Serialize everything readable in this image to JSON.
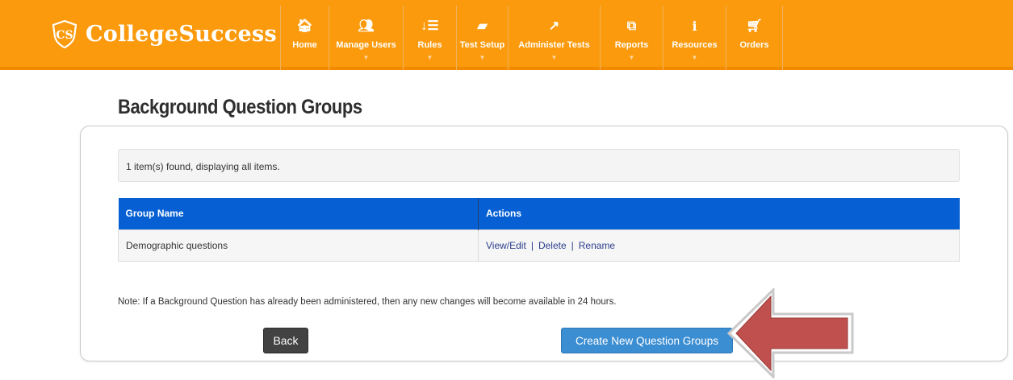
{
  "brand": {
    "name": "CollegeSuccess",
    "logo_icon": "cs-shield-logo"
  },
  "nav": {
    "items": [
      {
        "label": "Home",
        "icon": "home-icon",
        "glyph": "🏠︎",
        "has_dropdown": false
      },
      {
        "label": "Manage Users",
        "icon": "users-icon",
        "glyph": "👥︎",
        "has_dropdown": true
      },
      {
        "label": "Rules",
        "icon": "sort-icon",
        "glyph": "↓☰",
        "has_dropdown": true
      },
      {
        "label": "Test Setup",
        "icon": "book-icon",
        "glyph": "▰",
        "has_dropdown": true
      },
      {
        "label": "Administer Tests",
        "icon": "external-link-icon",
        "glyph": "↗",
        "has_dropdown": true
      },
      {
        "label": "Reports",
        "icon": "copy-icon",
        "glyph": "⧉",
        "has_dropdown": true
      },
      {
        "label": "Resources",
        "icon": "info-icon",
        "glyph": "i",
        "has_dropdown": true
      },
      {
        "label": "Orders",
        "icon": "cart-icon",
        "glyph": "🛒︎",
        "has_dropdown": false
      }
    ]
  },
  "page": {
    "title": "Background Question Groups"
  },
  "results": {
    "summary": "1 item(s) found, displaying all items."
  },
  "table": {
    "headers": {
      "name": "Group Name",
      "actions": "Actions"
    },
    "rows": [
      {
        "name": "Demographic questions",
        "actions": [
          "View/Edit",
          "Delete",
          "Rename"
        ],
        "separator": "|"
      }
    ]
  },
  "note": "Note: If a Background Question has already been administered, then any new changes will become available in 24 hours.",
  "buttons": {
    "back": "Back",
    "create": "Create New Question Groups"
  },
  "colors": {
    "header_bg": "#fb9a0c",
    "table_header": "#0660d3",
    "primary_button": "#3c8ed2",
    "back_button": "#424242",
    "arrow": "#c0504d"
  }
}
